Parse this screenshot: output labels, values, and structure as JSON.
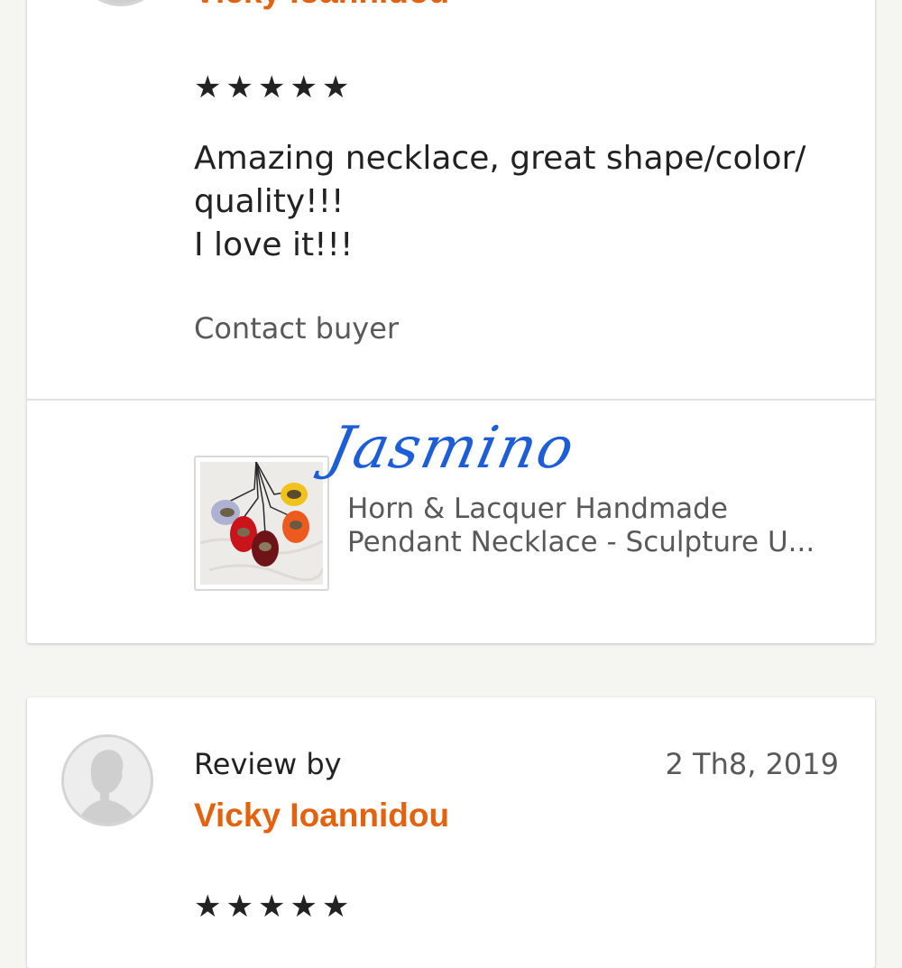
{
  "colors": {
    "background": "#f5f5f1",
    "card": "#ffffff",
    "accent_name": "#e3620f",
    "text_primary": "#222222",
    "text_secondary": "#595959",
    "divider": "#e1e1e1",
    "watermark": "#1d5ed6"
  },
  "reviews": [
    {
      "reviewer_name": "Vicky Ioannidou",
      "rating": 5,
      "stars": "★★★★★",
      "text_lines": [
        "Amazing necklace, great shape/color/",
        "quality!!!",
        "I love it!!!"
      ],
      "contact_label": "Contact buyer",
      "avatar_icon": "default-user-avatar-icon",
      "item": {
        "watermark": "Jasmino",
        "title_lines": [
          "Horn & Lacquer Handmade",
          "Pendant Necklace - Sculpture U..."
        ],
        "thumbnail_icon": "pendant-necklaces-thumbnail"
      }
    },
    {
      "review_by_label": "Review by",
      "reviewer_name": "Vicky Ioannidou",
      "date": "2 Th8, 2019",
      "rating": 5,
      "stars": "★★★★★",
      "avatar_icon": "default-user-avatar-icon"
    }
  ]
}
